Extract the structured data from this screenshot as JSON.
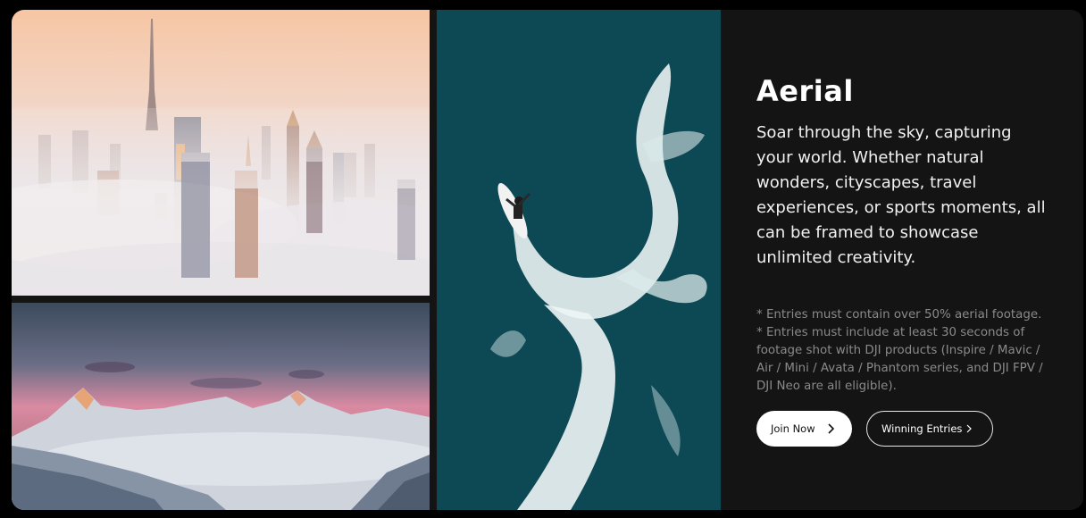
{
  "section": {
    "title": "Aerial",
    "description": "Soar through the sky, capturing your world. Whether natural wonders, cityscapes, travel experiences, or sports moments, all can be framed to showcase unlimited creativity.",
    "notes": [
      "* Entries must contain over 50% aerial footage.",
      "* Entries must include at least 30 seconds of footage shot with DJI products (Inspire / Mavic / Air / Mini / Avata / Phantom series, and DJI FPV / DJI Neo are all eligible)."
    ]
  },
  "buttons": {
    "join_label": "Join Now",
    "winning_label": "Winning Entries"
  },
  "icons": {
    "join": "chevron-right-icon",
    "winning": "chevron-right-icon"
  },
  "colors": {
    "card_background": "#141414",
    "primary_button_bg": "#ffffff",
    "note_text": "#8a8a8a",
    "ocean": "#0f4f5c"
  }
}
